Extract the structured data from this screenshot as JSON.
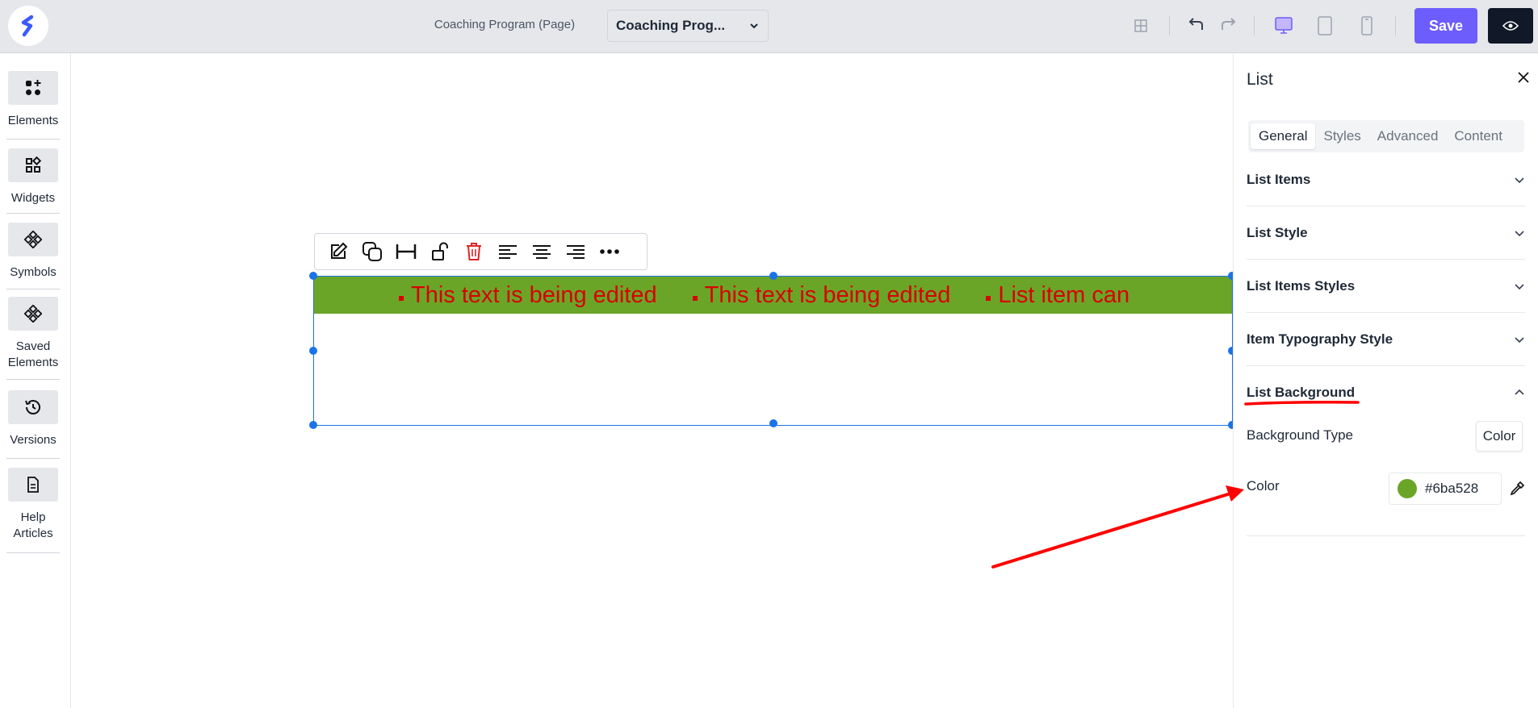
{
  "header": {
    "page_label": "Coaching Program (Page)",
    "page_select": "Coaching Prog...",
    "save_label": "Save",
    "icons": [
      "grid-icon",
      "undo-icon",
      "redo-icon",
      "desktop-icon",
      "tablet-icon",
      "mobile-icon",
      "eye-icon"
    ]
  },
  "sidebar": {
    "items": [
      {
        "label": "Elements",
        "icon": "elements-icon"
      },
      {
        "label": "Widgets",
        "icon": "widgets-icon"
      },
      {
        "label": "Symbols",
        "icon": "symbols-icon"
      },
      {
        "label": "Saved Elements",
        "icon": "saved-elements-icon"
      },
      {
        "label": "Versions",
        "icon": "history-icon"
      },
      {
        "label": "Help Articles",
        "icon": "document-icon"
      }
    ]
  },
  "canvas": {
    "list_items": [
      "This text is being edited",
      "This text is being edited",
      "List item can"
    ],
    "list_text_color": "#d90000"
  },
  "panel": {
    "title": "List",
    "tabs": [
      "General",
      "Styles",
      "Advanced",
      "Content"
    ],
    "active_tab": "General",
    "sections": [
      "List Items",
      "List Style",
      "List Items Styles",
      "Item Typography Style",
      "List Background"
    ],
    "background_type_label": "Background Type",
    "background_type_value": "Color",
    "color_label": "Color",
    "color_value": "#6ba528"
  },
  "colors": {
    "accent": "#6d5dfc",
    "selection": "#1a73e8",
    "list_background": "#6ba528",
    "annotation": "#ff0000"
  }
}
